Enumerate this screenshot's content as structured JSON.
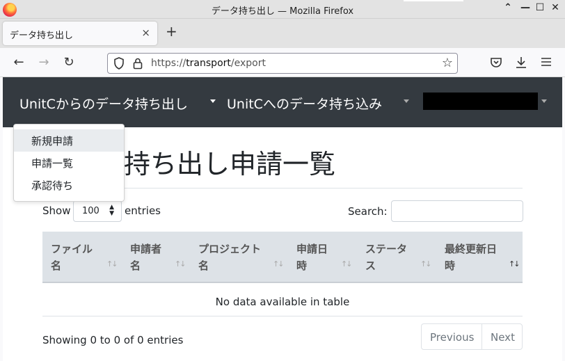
{
  "window": {
    "title": "データ持ち出し — Mozilla Firefox"
  },
  "window_controls": {
    "up": "⌃",
    "min": "—",
    "max": "☐",
    "close": "✕"
  },
  "tab": {
    "label": "データ持ち出し",
    "close": "×"
  },
  "newtab": "+",
  "nav": {
    "back": "←",
    "forward": "→",
    "reload": "↻"
  },
  "url": {
    "prefix": "https://",
    "host": "transport",
    "path": "/export"
  },
  "appnav": {
    "menu1": "UnitCからのデータ持ち出し",
    "menu2": "UnitCへのデータ持ち込み"
  },
  "dropdown": {
    "items": [
      "新規申請",
      "申請一覧",
      "承認待ち"
    ]
  },
  "heading": "持ち出し申請一覧",
  "length": {
    "show": "Show",
    "value": "100",
    "entries": "entries"
  },
  "search": {
    "label": "Search:",
    "value": ""
  },
  "table": {
    "headers": [
      {
        "line1": "ファイル",
        "line2": "名"
      },
      {
        "line1": "申請者",
        "line2": "名"
      },
      {
        "line1": "プロジェクト",
        "line2": "名"
      },
      {
        "line1": "申請日",
        "line2": "時"
      },
      {
        "line1": "ステータ",
        "line2": "ス"
      },
      {
        "line1": "最終更新日",
        "line2": "時"
      }
    ],
    "empty": "No data available in table"
  },
  "info": "Showing 0 to 0 of 0 entries",
  "pagination": {
    "previous": "Previous",
    "next": "Next"
  }
}
